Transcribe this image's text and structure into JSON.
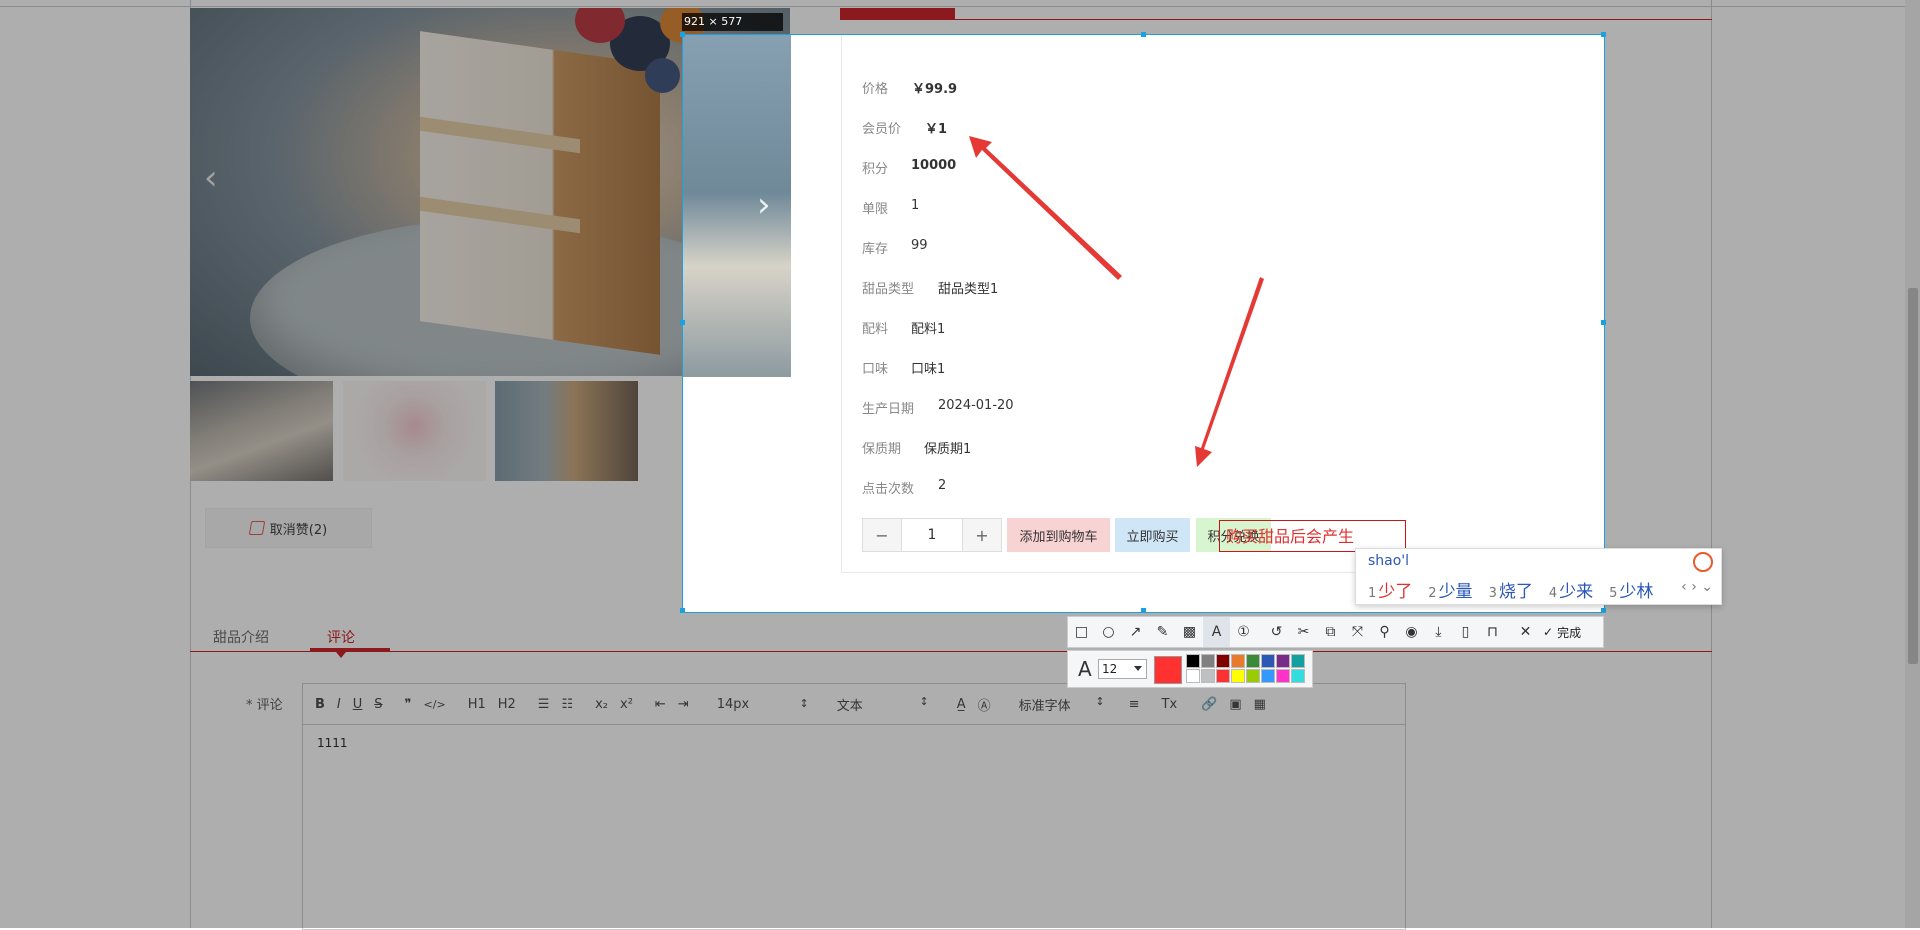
{
  "screenshot_overlay": {
    "dimension_label": "921 × 577",
    "annotation_text": "购买甜品后会产生",
    "annotation_color": "#e03030",
    "current_color": "#ff3131",
    "font_size": "12",
    "palette": [
      "#000000",
      "#808080",
      "#800000",
      "#e97a2b",
      "#3a8a3a",
      "#2b57b6",
      "#7a2b8a",
      "#12a0a0",
      "#ffffff",
      "#c0c0c0",
      "#ff3131",
      "#ffff00",
      "#99cc00",
      "#3399ff",
      "#ff33cc",
      "#33dddd"
    ],
    "toolbar_icons": [
      "rectangle-icon",
      "ellipse-icon",
      "arrow-icon",
      "pencil-icon",
      "mosaic-icon",
      "text-icon",
      "number-icon",
      "undo-icon",
      "ocr-icon",
      "translate-icon",
      "long-screenshot-icon",
      "pin-icon",
      "record-icon",
      "download-icon",
      "save-icon",
      "bookmark-icon",
      "close-icon"
    ],
    "done_label": "完成"
  },
  "ime": {
    "input": "shao'l",
    "candidates": [
      {
        "num": "1",
        "text": "少了"
      },
      {
        "num": "2",
        "text": "少量"
      },
      {
        "num": "3",
        "text": "烧了"
      },
      {
        "num": "4",
        "text": "少来"
      },
      {
        "num": "5",
        "text": "少林"
      }
    ]
  },
  "product": {
    "rows": [
      {
        "label": "价格",
        "value": "￥99.9"
      },
      {
        "label": "会员价",
        "value": "￥1"
      },
      {
        "label": "积分",
        "value": "10000"
      },
      {
        "label": "单限",
        "value": "1"
      },
      {
        "label": "库存",
        "value": "99"
      },
      {
        "label": "甜品类型",
        "value": "甜品类型1"
      },
      {
        "label": "配料",
        "value": "配料1"
      },
      {
        "label": "口味",
        "value": "口味1"
      },
      {
        "label": "生产日期",
        "value": "2024-01-20"
      },
      {
        "label": "保质期",
        "value": "保质期1"
      },
      {
        "label": "点击次数",
        "value": "2"
      }
    ],
    "quantity": "1",
    "minus": "−",
    "plus": "+",
    "buttons": {
      "add_cart": "添加到购物车",
      "buy_now": "立即购买",
      "points_exchange": "积分兑换"
    },
    "like_label": "取消赞(2)"
  },
  "tabs": [
    {
      "label": "甜品介绍"
    },
    {
      "label": "评论"
    }
  ],
  "comment": {
    "label": "* 评论",
    "content": "1111",
    "toolbar": {
      "bold": "B",
      "italic": "I",
      "underline": "U",
      "strike": "S",
      "quote": "❞",
      "code": "</>",
      "h1": "H1",
      "h2": "H2",
      "sub": "x₂",
      "sup": "x²",
      "font_size": "14px",
      "format": "文本",
      "font_family": "标准字体"
    }
  },
  "colors": {
    "accent": "#c8161d",
    "selection": "#1aa1e0",
    "add_cart_bg": "#f8d3d3",
    "buy_now_bg": "#cfe6f7",
    "exchange_bg": "#d7f5cf"
  }
}
